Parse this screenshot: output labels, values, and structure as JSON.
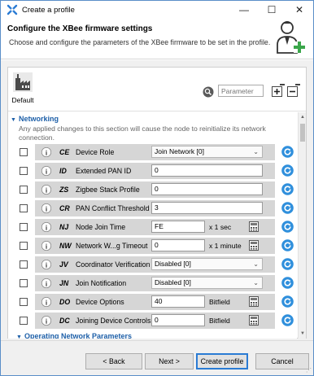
{
  "window": {
    "title": "Create a profile"
  },
  "header": {
    "title": "Configure the XBee firmware settings",
    "subtitle": "Choose and configure the parameters of the XBee firmware to be set in the profile."
  },
  "toolbar": {
    "default_label": "Default",
    "search_placeholder": "Parameter"
  },
  "sections": {
    "networking": {
      "title": "Networking",
      "description": "Any applied changes to this section will cause the node to reinitialize its network connection."
    },
    "operating": {
      "title": "Operating Network Parameters"
    }
  },
  "params": [
    {
      "code": "CE",
      "label": "Device Role",
      "kind": "select",
      "value": "Join Network [0]",
      "unit": ""
    },
    {
      "code": "ID",
      "label": "Extended PAN ID",
      "kind": "input",
      "value": "0",
      "unit": ""
    },
    {
      "code": "ZS",
      "label": "Zigbee Stack Profile",
      "kind": "input",
      "value": "0",
      "unit": ""
    },
    {
      "code": "CR",
      "label": "PAN Conflict Threshold",
      "kind": "input",
      "value": "3",
      "unit": ""
    },
    {
      "code": "NJ",
      "label": "Node Join Time",
      "kind": "input",
      "value": "FE",
      "unit": "x 1 sec"
    },
    {
      "code": "NW",
      "label": "Network W...g Timeout",
      "kind": "input",
      "value": "0",
      "unit": "x 1 minute"
    },
    {
      "code": "JV",
      "label": "Coordinator Verification",
      "kind": "select",
      "value": "Disabled [0]",
      "unit": ""
    },
    {
      "code": "JN",
      "label": "Join Notification",
      "kind": "select",
      "value": "Disabled [0]",
      "unit": ""
    },
    {
      "code": "DO",
      "label": "Device Options",
      "kind": "input",
      "value": "40",
      "unit": "Bitfield"
    },
    {
      "code": "DC",
      "label": "Joining Device Controls",
      "kind": "input",
      "value": "0",
      "unit": "Bitfield"
    }
  ],
  "footer": {
    "back": "< Back",
    "next": "Next >",
    "create": "Create profile",
    "cancel": "Cancel"
  },
  "colors": {
    "accent": "#1d5fa8",
    "refresh": "#2f8fdc"
  }
}
